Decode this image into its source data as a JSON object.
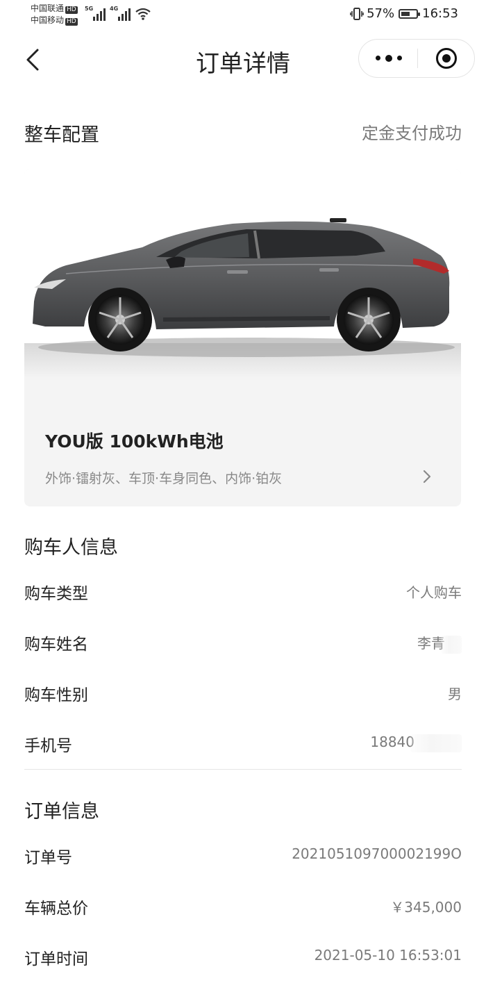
{
  "status_bar": {
    "carrier1": "中国联通",
    "carrier2": "中国移动",
    "hd": "HD",
    "net1": "5G",
    "net2": "4G",
    "battery_percent": "57%",
    "battery_level": 0.57,
    "time": "16:53",
    "icons": [
      "vibrate-icon",
      "wifi-icon",
      "battery-icon",
      "signal-icon"
    ]
  },
  "nav": {
    "title": "订单详情",
    "back_icon": "chevron-left-icon",
    "more_icon": "more-dots-icon",
    "close_icon": "target-ring-icon"
  },
  "config": {
    "heading": "整车配置",
    "status": "定金支付成功",
    "trim_name": "YOU版 100kWh电池",
    "trim_detail": "外饰·镭射灰、车顶·车身同色、内饰·铂灰"
  },
  "buyer": {
    "heading": "购车人信息",
    "rows": [
      {
        "label": "购车类型",
        "value": "个人购车"
      },
      {
        "label": "购车姓名",
        "value": "李青"
      },
      {
        "label": "购车性别",
        "value": "男"
      },
      {
        "label": "手机号",
        "value": "18840"
      }
    ]
  },
  "order": {
    "heading": "订单信息",
    "rows": [
      {
        "label": "订单号",
        "value": "202105109700002199O"
      },
      {
        "label": "车辆总价",
        "value": "￥345,000"
      },
      {
        "label": "订单时间",
        "value": "2021-05-10 16:53:01"
      }
    ]
  },
  "colors": {
    "text": "#222222",
    "muted": "#7a7a7a",
    "card_bg": "#f4f4f4",
    "car_body": "#5b5c5e"
  }
}
